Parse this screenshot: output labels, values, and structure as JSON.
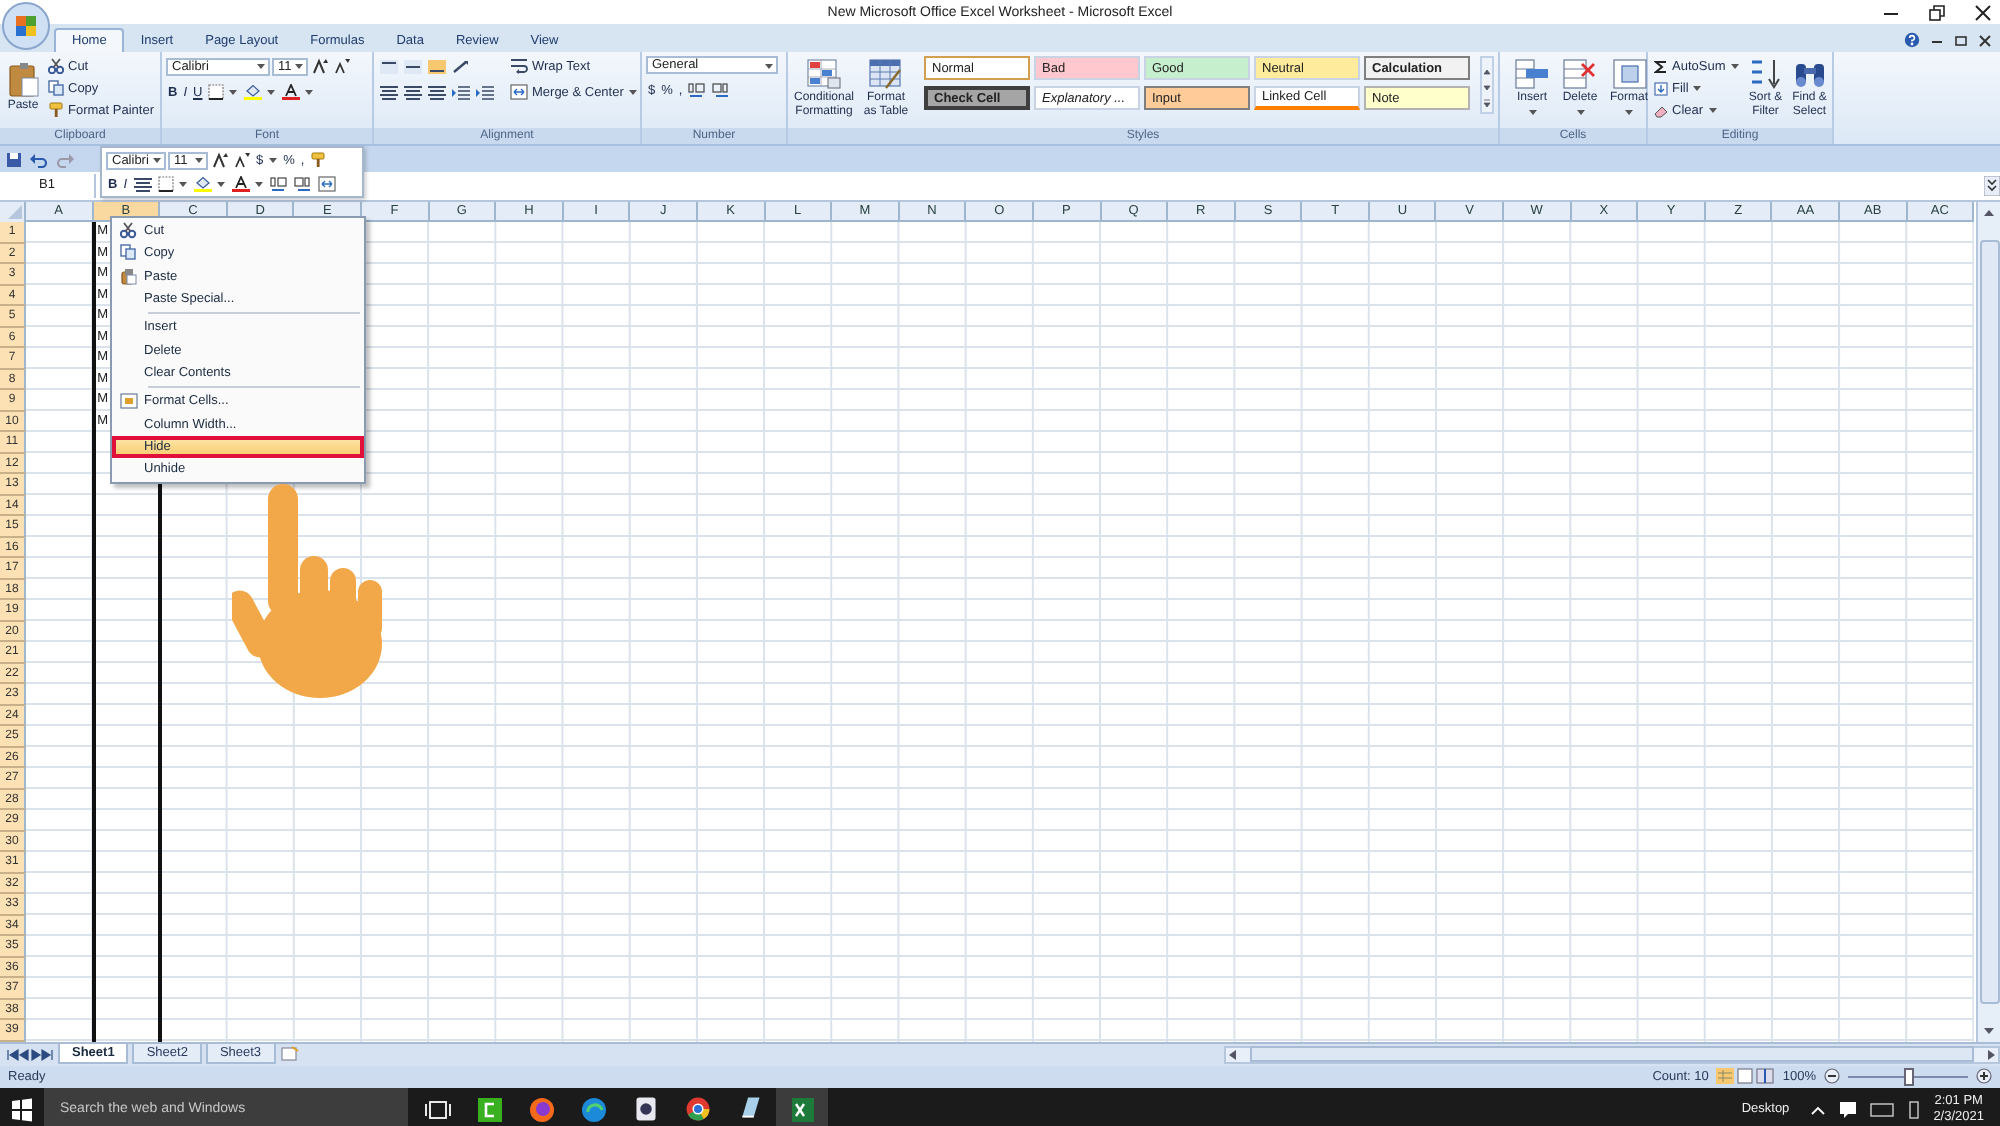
{
  "window": {
    "title": "New Microsoft Office Excel Worksheet - Microsoft Excel"
  },
  "tabs": [
    {
      "label": "Home",
      "selected": true
    },
    {
      "label": "Insert",
      "selected": false
    },
    {
      "label": "Page Layout",
      "selected": false
    },
    {
      "label": "Formulas",
      "selected": false
    },
    {
      "label": "Data",
      "selected": false
    },
    {
      "label": "Review",
      "selected": false
    },
    {
      "label": "View",
      "selected": false
    }
  ],
  "ribbon_groups": [
    {
      "kind": "clipboard",
      "label": "Clipboard",
      "large": "Paste",
      "small": [
        "Cut",
        "Copy",
        "Format Painter"
      ]
    },
    {
      "kind": "font",
      "label": "Font",
      "font": "Calibri",
      "size": "11",
      "format_buttons": [
        "B",
        "I",
        "U"
      ]
    },
    {
      "kind": "alignment",
      "label": "Alignment",
      "wrap": "Wrap Text",
      "merge": "Merge & Center"
    },
    {
      "kind": "number",
      "label": "Number",
      "format": "General",
      "symbols": [
        "$",
        "%",
        ","
      ]
    },
    {
      "kind": "styles",
      "label": "Styles",
      "large": [
        "Conditional Formatting",
        "Format as Table"
      ],
      "styles": [
        {
          "label": "Normal",
          "color": "#ffffff"
        },
        {
          "label": "Bad",
          "color": "#ffc7ce"
        },
        {
          "label": "Good",
          "color": "#c6efce"
        },
        {
          "label": "Neutral",
          "color": "#ffeb9c"
        },
        {
          "label": "Calculation",
          "color": "#f2f2f2"
        },
        {
          "label": "Check Cell",
          "color": "#a5a5a5"
        },
        {
          "label": "Explanatory ...",
          "color": "#ffffff"
        },
        {
          "label": "Input",
          "color": "#ffcc99"
        },
        {
          "label": "Linked Cell",
          "color": "#ffffff"
        },
        {
          "label": "Note",
          "color": "#ffffcc"
        }
      ]
    },
    {
      "kind": "cells",
      "label": "Cells",
      "large": [
        "Insert",
        "Delete",
        "Format"
      ]
    },
    {
      "kind": "editing",
      "label": "Editing",
      "small": [
        "AutoSum",
        "Fill",
        "Clear"
      ],
      "large": [
        "Sort & Filter",
        "Find & Select"
      ]
    }
  ],
  "mini_toolbar": {
    "font": "Calibri",
    "size": "11",
    "symbols": [
      "$",
      "%",
      ","
    ],
    "format_buttons": [
      "B",
      "I"
    ]
  },
  "name_box": "B1",
  "columns": [
    {
      "label": "A",
      "selected": false
    },
    {
      "label": "B",
      "selected": true
    },
    {
      "label": "C",
      "selected": false
    },
    {
      "label": "D",
      "selected": false
    },
    {
      "label": "E",
      "selected": false
    },
    {
      "label": "F",
      "selected": false
    },
    {
      "label": "G",
      "selected": false
    },
    {
      "label": "H",
      "selected": false
    },
    {
      "label": "I",
      "selected": false
    },
    {
      "label": "J",
      "selected": false
    },
    {
      "label": "K",
      "selected": false
    },
    {
      "label": "L",
      "selected": false
    },
    {
      "label": "M",
      "selected": false
    },
    {
      "label": "N",
      "selected": false
    },
    {
      "label": "O",
      "selected": false
    },
    {
      "label": "P",
      "selected": false
    },
    {
      "label": "Q",
      "selected": false
    },
    {
      "label": "R",
      "selected": false
    },
    {
      "label": "S",
      "selected": false
    },
    {
      "label": "T",
      "selected": false
    },
    {
      "label": "U",
      "selected": false
    },
    {
      "label": "V",
      "selected": false
    },
    {
      "label": "W",
      "selected": false
    },
    {
      "label": "X",
      "selected": false
    },
    {
      "label": "Y",
      "selected": false
    },
    {
      "label": "Z",
      "selected": false
    },
    {
      "label": "AA",
      "selected": false
    },
    {
      "label": "AB",
      "selected": false
    },
    {
      "label": "AC",
      "selected": false
    }
  ],
  "rows": [
    {
      "header": "1",
      "column_b": "M"
    },
    {
      "header": "2",
      "column_b": "M"
    },
    {
      "header": "3",
      "column_b": "M"
    },
    {
      "header": "4",
      "column_b": "M"
    },
    {
      "header": "5",
      "column_b": "M"
    },
    {
      "header": "6",
      "column_b": "M"
    },
    {
      "header": "7",
      "column_b": "M"
    },
    {
      "header": "8",
      "column_b": "M"
    },
    {
      "header": "9",
      "column_b": "M"
    },
    {
      "header": "10",
      "column_b": "M"
    },
    {
      "header": "11"
    },
    {
      "header": "12"
    },
    {
      "header": "13"
    },
    {
      "header": "14"
    },
    {
      "header": "15"
    },
    {
      "header": "16"
    },
    {
      "header": "17"
    },
    {
      "header": "18"
    },
    {
      "header": "19"
    },
    {
      "header": "20"
    },
    {
      "header": "21"
    },
    {
      "header": "22"
    },
    {
      "header": "23"
    },
    {
      "header": "24"
    },
    {
      "header": "25"
    },
    {
      "header": "26"
    },
    {
      "header": "27"
    },
    {
      "header": "28"
    },
    {
      "header": "29"
    },
    {
      "header": "30"
    },
    {
      "header": "31"
    },
    {
      "header": "32"
    },
    {
      "header": "33"
    },
    {
      "header": "34"
    },
    {
      "header": "35"
    },
    {
      "header": "36"
    },
    {
      "header": "37"
    },
    {
      "header": "38"
    },
    {
      "header": "39"
    }
  ],
  "context_menu": {
    "groups": [
      {
        "items": [
          {
            "label": "Cut",
            "highlighted": false,
            "annotated": false
          },
          {
            "label": "Copy",
            "highlighted": false,
            "annotated": false
          },
          {
            "label": "Paste",
            "highlighted": false,
            "annotated": false
          },
          {
            "label": "Paste Special...",
            "highlighted": false,
            "annotated": false
          }
        ]
      },
      {
        "items": [
          {
            "label": "Insert",
            "highlighted": false,
            "annotated": false
          },
          {
            "label": "Delete",
            "highlighted": false,
            "annotated": false
          },
          {
            "label": "Clear Contents",
            "highlighted": false,
            "annotated": false
          }
        ]
      },
      {
        "items": [
          {
            "label": "Format Cells...",
            "highlighted": false,
            "annotated": false
          },
          {
            "label": "Column Width...",
            "highlighted": false,
            "annotated": false
          },
          {
            "label": "Hide",
            "highlighted": true,
            "annotated": true
          },
          {
            "label": "Unhide",
            "highlighted": false,
            "annotated": false
          }
        ]
      }
    ]
  },
  "overlay": {
    "hand_pointer": true
  },
  "sheet_tabs": [
    {
      "label": "Sheet1",
      "selected": true
    },
    {
      "label": "Sheet2",
      "selected": false
    },
    {
      "label": "Sheet3",
      "selected": false
    }
  ],
  "status_bar": {
    "status": "Ready",
    "count": "Count: 10",
    "zoom": "100%",
    "zoom_slider": {
      "level": 0.5
    }
  },
  "taskbar": {
    "search_placeholder": "Search the web and Windows",
    "desktop": "Desktop",
    "time": "2:01 PM",
    "date": "2/3/2021"
  }
}
